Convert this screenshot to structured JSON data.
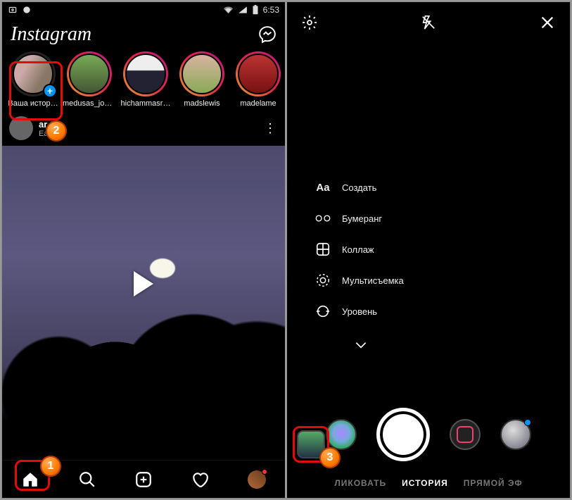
{
  "status": {
    "time": "6:53"
  },
  "header": {
    "logo": "Instagram"
  },
  "stories": [
    {
      "label": "Ваша истор…",
      "own": true
    },
    {
      "label": "medusas_jou…"
    },
    {
      "label": "hichammasr…"
    },
    {
      "label": "madslewis"
    },
    {
      "label": "madelame"
    }
  ],
  "post": {
    "user": "ar         tw",
    "sub": "Ea"
  },
  "camera": {
    "modes": [
      {
        "icon": "Aa",
        "label": "Создать"
      },
      {
        "icon": "∞",
        "label": "Бумеранг"
      },
      {
        "icon": "⊞",
        "label": "Коллаж"
      },
      {
        "icon": "◎",
        "label": "Мультисъемка"
      },
      {
        "icon": "⊖",
        "label": "Уровень"
      }
    ],
    "tabs": {
      "publish": "ЛИКОВАТЬ",
      "story": "ИСТОРИЯ",
      "live": "ПРЯМОЙ ЭФ"
    }
  },
  "annotations": {
    "b1": "1",
    "b2": "2",
    "b3": "3"
  }
}
